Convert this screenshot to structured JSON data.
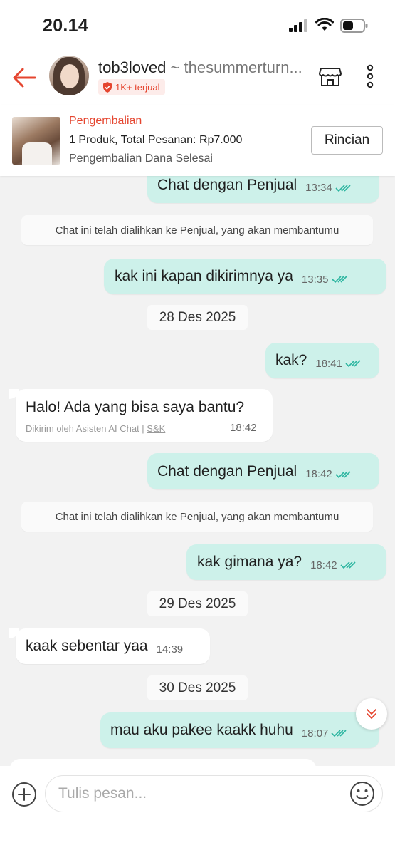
{
  "status_bar": {
    "time": "20.14"
  },
  "header": {
    "shop_name": "tob3loved",
    "shop_handle": "~ thesummerturn...",
    "badge": "1K+ terjual"
  },
  "order": {
    "title": "Pengembalian",
    "summary": "1 Produk, Total Pesanan: Rp7.000",
    "status": "Pengembalian Dana Selesai",
    "button": "Rincian"
  },
  "messages": [
    {
      "type": "out",
      "text": "Chat dengan Penjual",
      "time": "13:34"
    },
    {
      "type": "system",
      "text": "Chat ini telah dialihkan ke Penjual, yang akan membantumu"
    },
    {
      "type": "out",
      "text": "kak ini kapan dikirimnya ya",
      "time": "13:35"
    },
    {
      "type": "date",
      "text": "28 Des 2025"
    },
    {
      "type": "out",
      "text": "kak?",
      "time": "18:41"
    },
    {
      "type": "in",
      "text": "Halo! Ada yang bisa saya bantu?",
      "note_prefix": "Dikirim oleh Asisten AI Chat | ",
      "note_link": "S&K",
      "time": "18:42"
    },
    {
      "type": "out",
      "text": "Chat dengan Penjual",
      "time": "18:42"
    },
    {
      "type": "system",
      "text": "Chat ini telah dialihkan ke Penjual, yang akan membantumu"
    },
    {
      "type": "out",
      "text": "kak gimana ya?",
      "time": "18:42"
    },
    {
      "type": "date",
      "text": "29 Des 2025"
    },
    {
      "type": "in",
      "text": "kaak sebentar yaa",
      "time": "14:39"
    },
    {
      "type": "date",
      "text": "30 Des 2025"
    },
    {
      "type": "out",
      "text": "mau aku pakee kaakk huhu",
      "time": "18:07"
    }
  ],
  "input": {
    "placeholder": "Tulis pesan..."
  },
  "colors": {
    "accent": "#e5452f",
    "out_bubble": "#cdf1ea",
    "read_tick": "#2bb5a0"
  },
  "icons": [
    "back-arrow-icon",
    "shield-icon",
    "shop-icon",
    "more-vertical-icon",
    "double-check-icon",
    "chevron-double-down-icon",
    "plus-circle-icon",
    "emoji-icon"
  ]
}
